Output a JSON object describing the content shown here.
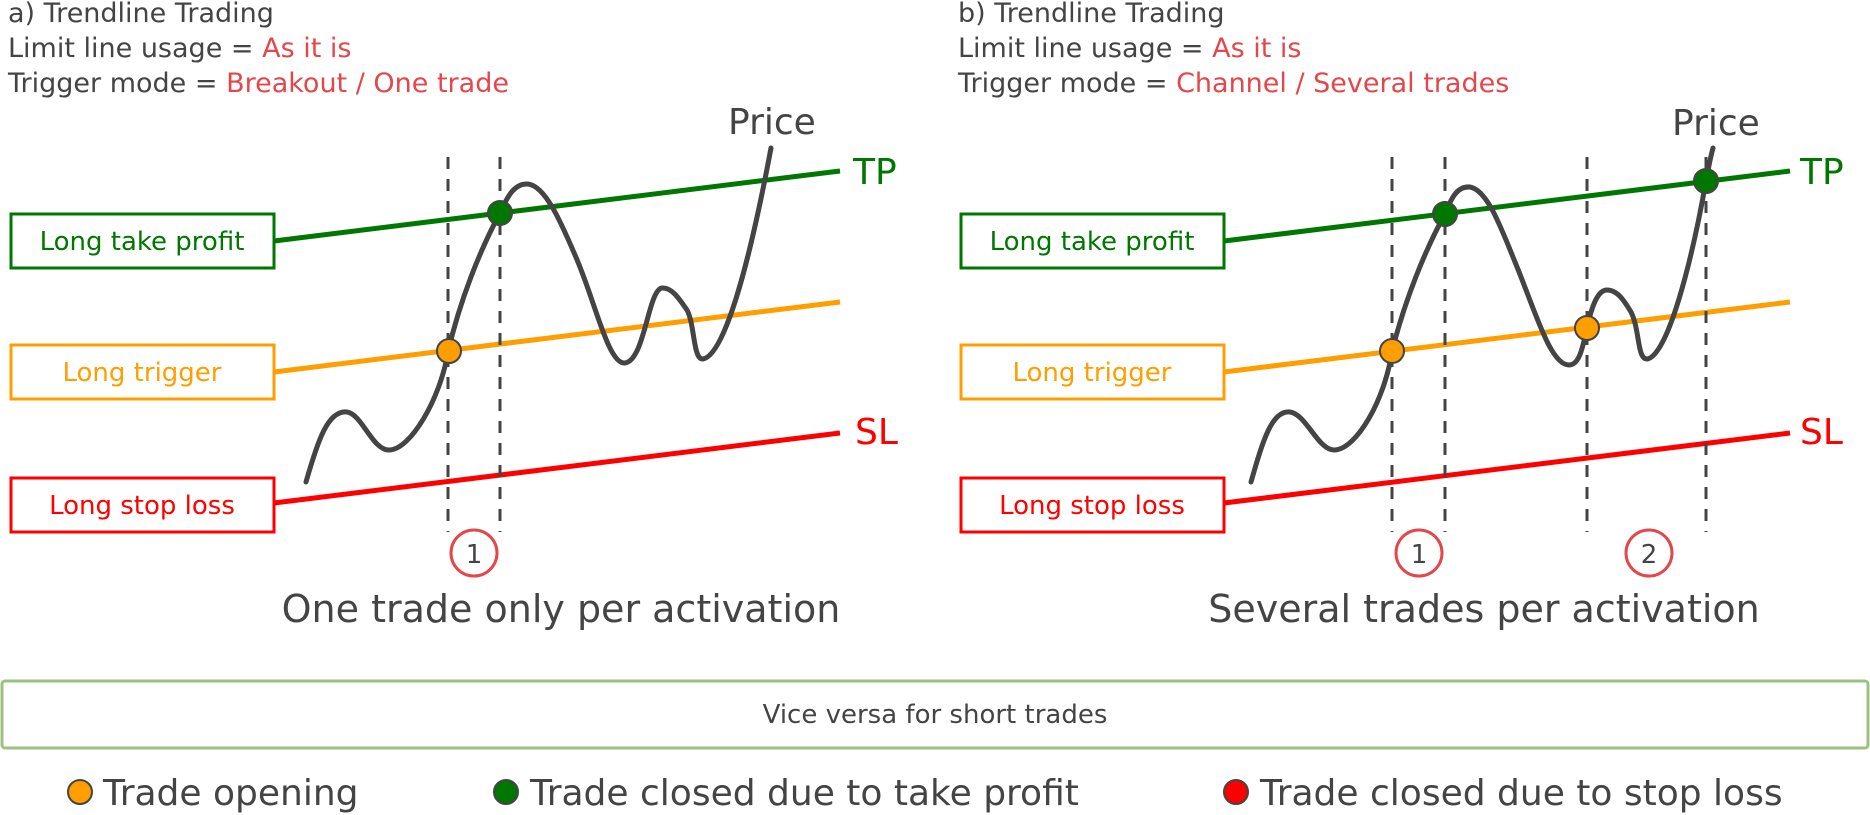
{
  "colors": {
    "take_profit": "#007700",
    "trigger": "#ff9e00",
    "stop_loss": "#ff0000",
    "price": "#444444",
    "highlight": "#e4474b",
    "note_border": "#9bc07f",
    "marker_ring": "#e4474b"
  },
  "panels": [
    {
      "title": "a) Trendline Trading",
      "limit_label": "Limit line usage = ",
      "limit_value": "As it is",
      "trigger_label": "Trigger mode = ",
      "trigger_value": "Breakout / One trade",
      "price_label": "Price",
      "tp_label": "TP",
      "sl_label": "SL",
      "boxes": {
        "take_profit": "Long take profit",
        "trigger": "Long trigger",
        "stop_loss": "Long stop loss"
      },
      "trade_markers": [
        "1"
      ],
      "caption": "One trade only per activation",
      "events": [
        {
          "type": "open",
          "trade": 1
        },
        {
          "type": "tp",
          "trade": 1
        }
      ]
    },
    {
      "title": "b) Trendline Trading",
      "limit_label": "Limit line usage = ",
      "limit_value": "As it is",
      "trigger_label": "Trigger mode = ",
      "trigger_value": "Channel / Several trades",
      "price_label": "Price",
      "tp_label": "TP",
      "sl_label": "SL",
      "boxes": {
        "take_profit": "Long take profit",
        "trigger": "Long trigger",
        "stop_loss": "Long stop loss"
      },
      "trade_markers": [
        "1",
        "2"
      ],
      "caption": "Several trades per activation",
      "events": [
        {
          "type": "open",
          "trade": 1
        },
        {
          "type": "tp",
          "trade": 1
        },
        {
          "type": "open",
          "trade": 2
        },
        {
          "type": "tp",
          "trade": 2
        }
      ]
    }
  ],
  "note": "Vice versa for short trades",
  "legend": [
    {
      "icon": "orange-dot",
      "label": "Trade opening"
    },
    {
      "icon": "green-dot",
      "label": "Trade closed due to take profit"
    },
    {
      "icon": "red-dot",
      "label": "Trade closed due to stop loss"
    }
  ]
}
